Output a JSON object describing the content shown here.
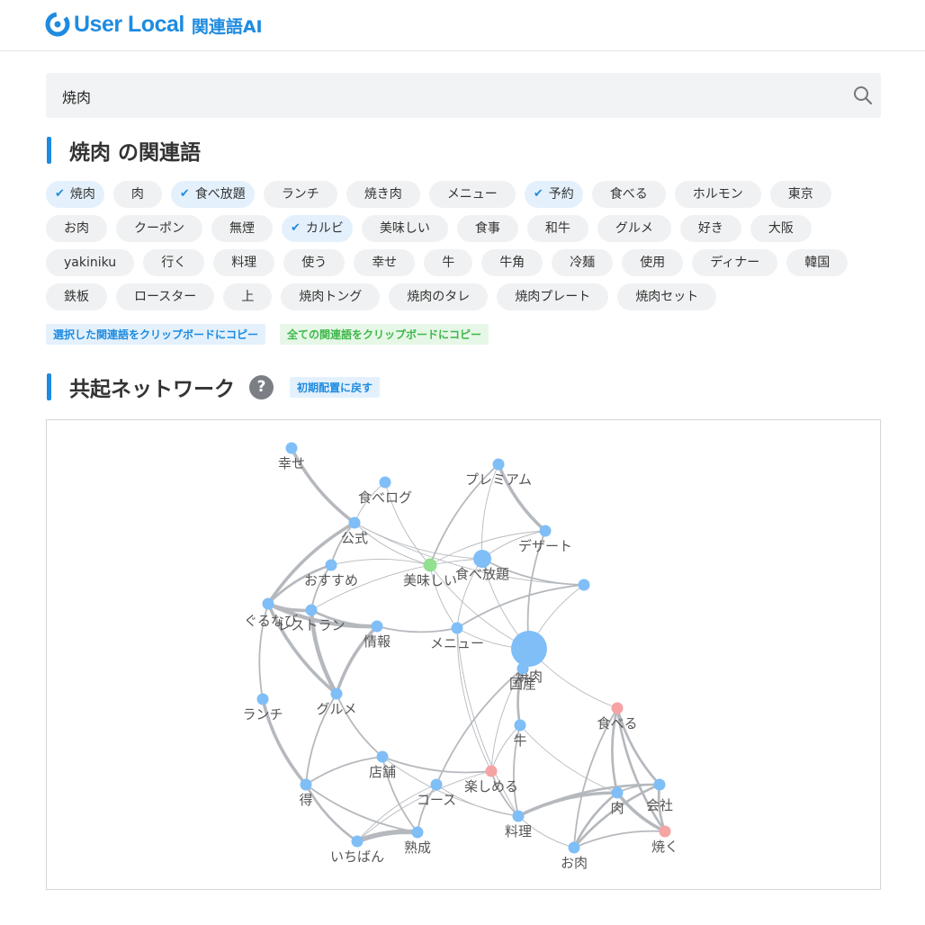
{
  "header": {
    "logo_text": "User Local",
    "logo_sub": "関連語AI"
  },
  "search": {
    "value": "焼肉",
    "placeholder": ""
  },
  "related": {
    "title": "焼肉 の関連語",
    "rows": [
      [
        {
          "label": "焼肉",
          "selected": true
        },
        {
          "label": "肉",
          "selected": false
        },
        {
          "label": "食べ放題",
          "selected": true
        },
        {
          "label": "ランチ",
          "selected": false
        },
        {
          "label": "焼き肉",
          "selected": false
        },
        {
          "label": "メニュー",
          "selected": false
        },
        {
          "label": "予約",
          "selected": true
        },
        {
          "label": "食べる",
          "selected": false
        },
        {
          "label": "ホルモン",
          "selected": false
        },
        {
          "label": "東京",
          "selected": false
        }
      ],
      [
        {
          "label": "お肉",
          "selected": false
        },
        {
          "label": "クーポン",
          "selected": false
        },
        {
          "label": "無煙",
          "selected": false
        },
        {
          "label": "カルビ",
          "selected": true
        },
        {
          "label": "美味しい",
          "selected": false
        },
        {
          "label": "食事",
          "selected": false
        },
        {
          "label": "和牛",
          "selected": false
        },
        {
          "label": "グルメ",
          "selected": false
        },
        {
          "label": "好き",
          "selected": false
        },
        {
          "label": "大阪",
          "selected": false
        }
      ],
      [
        {
          "label": "yakiniku",
          "selected": false
        },
        {
          "label": "行く",
          "selected": false
        },
        {
          "label": "料理",
          "selected": false
        },
        {
          "label": "使う",
          "selected": false
        },
        {
          "label": "幸せ",
          "selected": false
        },
        {
          "label": "牛",
          "selected": false
        },
        {
          "label": "牛角",
          "selected": false
        },
        {
          "label": "冷麺",
          "selected": false
        },
        {
          "label": "使用",
          "selected": false
        },
        {
          "label": "ディナー",
          "selected": false
        },
        {
          "label": "韓国",
          "selected": false
        }
      ],
      [
        {
          "label": "鉄板",
          "selected": false
        },
        {
          "label": "ロースター",
          "selected": false
        },
        {
          "label": "上",
          "selected": false
        },
        {
          "label": "焼肉トング",
          "selected": false
        },
        {
          "label": "焼肉のタレ",
          "selected": false
        },
        {
          "label": "焼肉プレート",
          "selected": false
        },
        {
          "label": "焼肉セット",
          "selected": false
        }
      ]
    ],
    "copy_selected": "選択した関連語をクリップボードにコピー",
    "copy_all": "全ての関連語をクリップボードにコピー"
  },
  "network": {
    "title": "共起ネットワーク",
    "help": "?",
    "reset": "初期配置に戻す",
    "colors": {
      "blue": "#7fbef7",
      "green": "#90e090",
      "red": "#f5a3a3",
      "edge": "#b5b9be"
    },
    "nodes": [
      {
        "id": "幸せ",
        "label": "幸せ",
        "color": "blue"
      },
      {
        "id": "食べログ",
        "label": "食べログ",
        "color": "blue"
      },
      {
        "id": "プレミアム",
        "label": "プレミアム",
        "color": "blue"
      },
      {
        "id": "公式",
        "label": "公式",
        "color": "blue"
      },
      {
        "id": "デザート",
        "label": "デザート",
        "color": "blue"
      },
      {
        "id": "美味しい",
        "label": "美味しい",
        "color": "green"
      },
      {
        "id": "食べ放題",
        "label": "食べ放題",
        "color": "blue"
      },
      {
        "id": "おすすめ",
        "label": "おすすめ",
        "color": "blue"
      },
      {
        "id": "無名",
        "label": "",
        "color": "blue"
      },
      {
        "id": "ぐるなび",
        "label": "ぐるなび",
        "color": "blue"
      },
      {
        "id": "レストラン",
        "label": "レストラン",
        "color": "blue"
      },
      {
        "id": "情報",
        "label": "情報",
        "color": "blue"
      },
      {
        "id": "メニュー",
        "label": "メニュー",
        "color": "blue"
      },
      {
        "id": "焼肉",
        "label": "焼肉",
        "color": "blue"
      },
      {
        "id": "国産",
        "label": "国産",
        "color": "blue"
      },
      {
        "id": "ランチ",
        "label": "ランチ",
        "color": "blue"
      },
      {
        "id": "グルメ",
        "label": "グルメ",
        "color": "blue"
      },
      {
        "id": "食べる",
        "label": "食べる",
        "color": "red"
      },
      {
        "id": "牛",
        "label": "牛",
        "color": "blue"
      },
      {
        "id": "店舗",
        "label": "店舗",
        "color": "blue"
      },
      {
        "id": "楽しめる",
        "label": "楽しめる",
        "color": "red"
      },
      {
        "id": "コース",
        "label": "コース",
        "color": "blue"
      },
      {
        "id": "得",
        "label": "得",
        "color": "blue"
      },
      {
        "id": "会社",
        "label": "会社",
        "color": "blue"
      },
      {
        "id": "肉",
        "label": "肉",
        "color": "blue"
      },
      {
        "id": "料理",
        "label": "料理",
        "color": "blue"
      },
      {
        "id": "熟成",
        "label": "熟成",
        "color": "blue"
      },
      {
        "id": "焼く",
        "label": "焼く",
        "color": "red"
      },
      {
        "id": "いちばん",
        "label": "いちばん",
        "color": "blue"
      },
      {
        "id": "お肉",
        "label": "お肉",
        "color": "blue"
      }
    ],
    "edges": [
      [
        "幸せ",
        "公式",
        4
      ],
      [
        "公式",
        "ぐるなび",
        4
      ],
      [
        "公式",
        "おすすめ",
        2
      ],
      [
        "公式",
        "食べ放題",
        1
      ],
      [
        "公式",
        "美味しい",
        1
      ],
      [
        "公式",
        "無名",
        1
      ],
      [
        "食べログ",
        "公式",
        1
      ],
      [
        "食べログ",
        "美味しい",
        1
      ],
      [
        "プレミアム",
        "デザート",
        4
      ],
      [
        "プレミアム",
        "美味しい",
        2
      ],
      [
        "プレミアム",
        "食べ放題",
        1
      ],
      [
        "デザート",
        "焼肉",
        2
      ],
      [
        "デザート",
        "食べ放題",
        1
      ],
      [
        "デザート",
        "美味しい",
        1
      ],
      [
        "美味しい",
        "焼肉",
        1
      ],
      [
        "美味しい",
        "メニュー",
        1
      ],
      [
        "美味しい",
        "おすすめ",
        1
      ],
      [
        "食べ放題",
        "無名",
        2
      ],
      [
        "食べ放題",
        "メニュー",
        1
      ],
      [
        "食べ放題",
        "焼肉",
        1
      ],
      [
        "食べ放題",
        "レストラン",
        1
      ],
      [
        "無名",
        "メニュー",
        2
      ],
      [
        "無名",
        "焼肉",
        1
      ],
      [
        "おすすめ",
        "ぐるなび",
        3
      ],
      [
        "おすすめ",
        "レストラン",
        2
      ],
      [
        "ぐるなび",
        "レストラン",
        4
      ],
      [
        "ぐるなび",
        "情報",
        5
      ],
      [
        "ぐるなび",
        "グルメ",
        4
      ],
      [
        "ぐるなび",
        "ランチ",
        2
      ],
      [
        "レストラン",
        "グルメ",
        5
      ],
      [
        "レストラン",
        "情報",
        3
      ],
      [
        "情報",
        "グルメ",
        4
      ],
      [
        "情報",
        "メニュー",
        2
      ],
      [
        "メニュー",
        "焼肉",
        1
      ],
      [
        "メニュー",
        "楽しめる",
        1
      ],
      [
        "メニュー",
        "料理",
        1
      ],
      [
        "焼肉",
        "国産",
        2
      ],
      [
        "焼肉",
        "食べる",
        1
      ],
      [
        "国産",
        "牛",
        3
      ],
      [
        "国産",
        "コース",
        2
      ],
      [
        "国産",
        "楽しめる",
        1
      ],
      [
        "ランチ",
        "得",
        4
      ],
      [
        "グルメ",
        "店舗",
        2
      ],
      [
        "グルメ",
        "得",
        2
      ],
      [
        "食べる",
        "肉",
        3
      ],
      [
        "食べる",
        "会社",
        3
      ],
      [
        "食べる",
        "焼く",
        3
      ],
      [
        "食べる",
        "お肉",
        2
      ],
      [
        "牛",
        "料理",
        2
      ],
      [
        "牛",
        "肉",
        1
      ],
      [
        "牛",
        "楽しめる",
        1
      ],
      [
        "店舗",
        "楽しめる",
        2
      ],
      [
        "店舗",
        "得",
        2
      ],
      [
        "店舗",
        "熟成",
        2
      ],
      [
        "店舗",
        "料理",
        1
      ],
      [
        "楽しめる",
        "料理",
        2
      ],
      [
        "楽しめる",
        "いちばん",
        1
      ],
      [
        "コース",
        "熟成",
        2
      ],
      [
        "コース",
        "料理",
        1
      ],
      [
        "コース",
        "いちばん",
        1
      ],
      [
        "得",
        "熟成",
        2
      ],
      [
        "得",
        "いちばん",
        3
      ],
      [
        "会社",
        "焼く",
        3
      ],
      [
        "会社",
        "肉",
        2
      ],
      [
        "会社",
        "お肉",
        3
      ],
      [
        "会社",
        "料理",
        3
      ],
      [
        "肉",
        "焼く",
        4
      ],
      [
        "肉",
        "料理",
        4
      ],
      [
        "肉",
        "お肉",
        3
      ],
      [
        "料理",
        "お肉",
        1
      ],
      [
        "熟成",
        "いちばん",
        6
      ],
      [
        "焼く",
        "お肉",
        2
      ]
    ]
  }
}
